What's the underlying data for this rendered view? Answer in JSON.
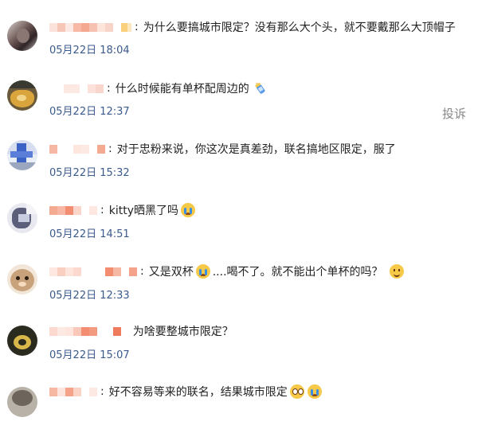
{
  "report_label": "投诉",
  "comments": [
    {
      "text": "为什么要搞城市限定？没有那么大个头，就不要戴那么大顶帽子",
      "date": "05月22日",
      "time": "18:04",
      "emoji": ""
    },
    {
      "text": "什么时候能有单杯配周边的",
      "date": "05月22日",
      "time": "12:37",
      "emoji": "feeding-bottle-emoji"
    },
    {
      "text": "对于忠粉来说，你这次是真差劲，联名搞地区限定，服了",
      "date": "05月22日",
      "time": "15:32",
      "emoji": ""
    },
    {
      "text": "kitty晒黑了吗",
      "date": "05月22日",
      "time": "14:51",
      "emoji": "crying-face-emoji"
    },
    {
      "text": "又是双杯",
      "text2": "....喝不了。就不能出个单杯的吗？",
      "date": "05月22日",
      "time": "12:33",
      "emoji": "crying-face-emoji",
      "emoji2": "slight-smile-emoji"
    },
    {
      "text": "为啥要整城市限定？",
      "date": "05月22日",
      "time": "15:07",
      "emoji": ""
    },
    {
      "text": "好不容易等来的联名，结果城市限定",
      "date": "",
      "time": "",
      "emoji": "pleading-face-emoji",
      "emoji2": "crying-face-emoji"
    }
  ]
}
